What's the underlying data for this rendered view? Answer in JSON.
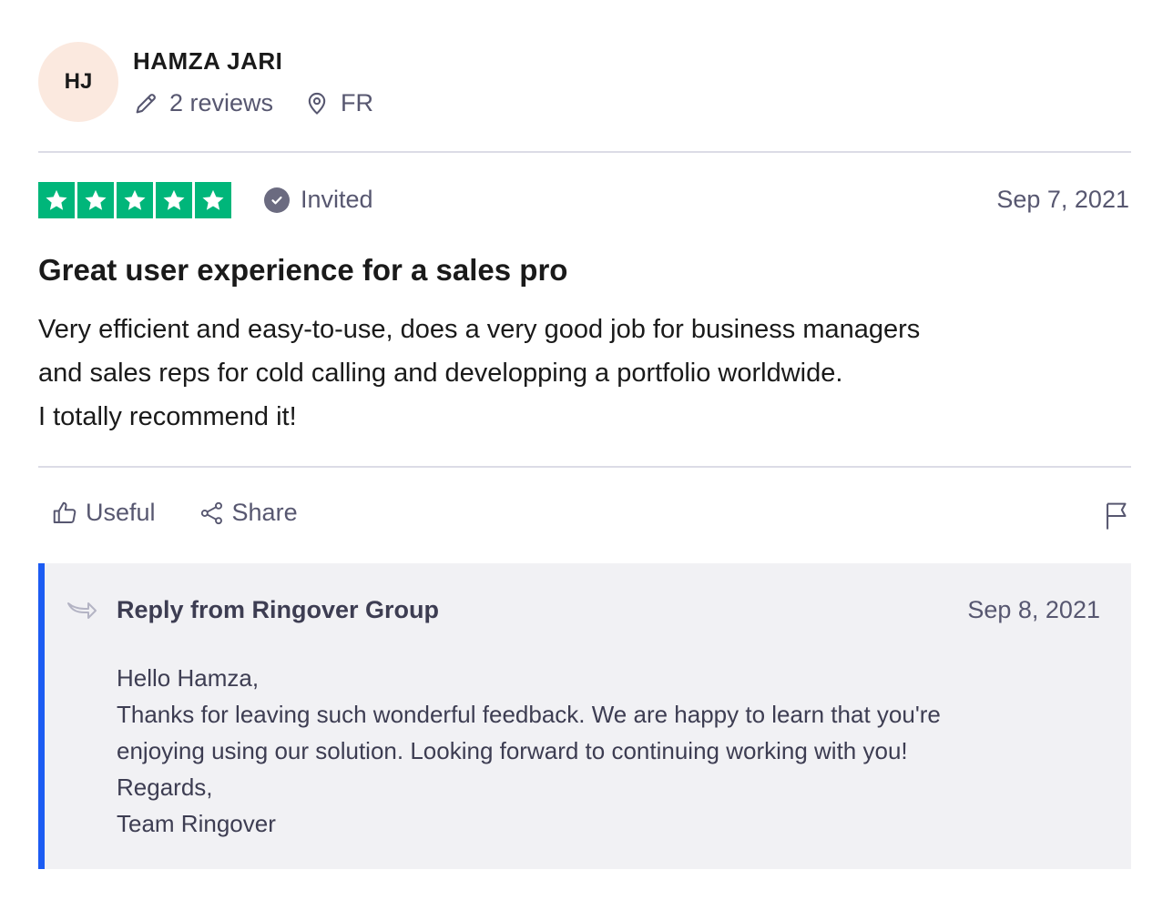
{
  "consumer": {
    "initials": "HJ",
    "name": "HAMZA JARI",
    "reviews": "2 reviews",
    "country": "FR"
  },
  "review": {
    "rating": 5,
    "rating_color": "#00b67a",
    "invited_label": "Invited",
    "date": "Sep 7, 2021",
    "title": "Great user experience for a sales pro",
    "body_lines": [
      "Very efficient and easy-to-use, does a very good job for business managers",
      "and sales reps for cold calling and developping a portfolio worldwide.",
      "I totally recommend it!"
    ]
  },
  "actions": {
    "useful_label": "Useful",
    "share_label": "Share"
  },
  "reply": {
    "title": "Reply from Ringover Group",
    "date": "Sep 8, 2021",
    "accent_color": "#1c5cf3",
    "body_lines": [
      "Hello Hamza,",
      "Thanks for leaving such wonderful feedback. We are happy to learn that you're",
      "enjoying using our solution. Looking forward to continuing working with you!",
      "Regards,",
      "Team Ringover"
    ]
  }
}
